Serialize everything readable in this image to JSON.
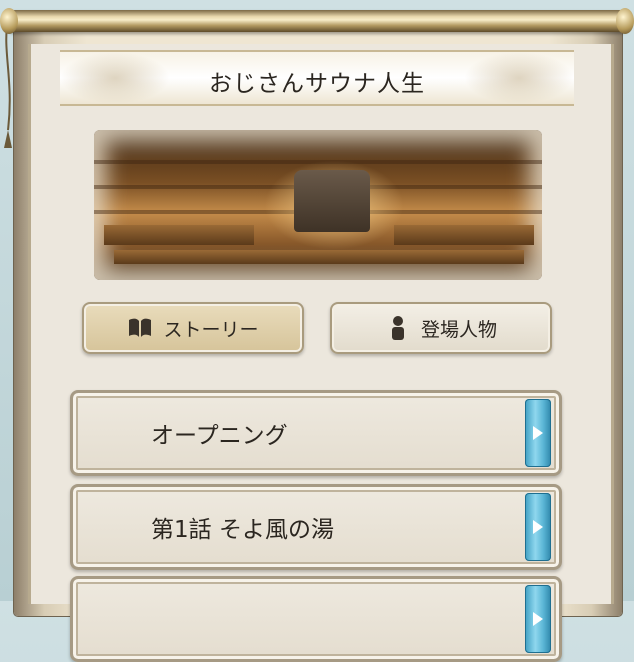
{
  "header": {
    "title": "おじさんサウナ人生"
  },
  "tabs": [
    {
      "label": "ストーリー",
      "icon": "book-icon",
      "active": true
    },
    {
      "label": "登場人物",
      "icon": "person-icon",
      "active": false
    }
  ],
  "chapters": [
    {
      "label": "オープニング"
    },
    {
      "label": "第1話  そよ風の湯"
    },
    {
      "label": ""
    }
  ],
  "colors": {
    "accent_blue": "#5bb6d6",
    "active_tab": "#d6c49a",
    "text": "#2b2620"
  }
}
